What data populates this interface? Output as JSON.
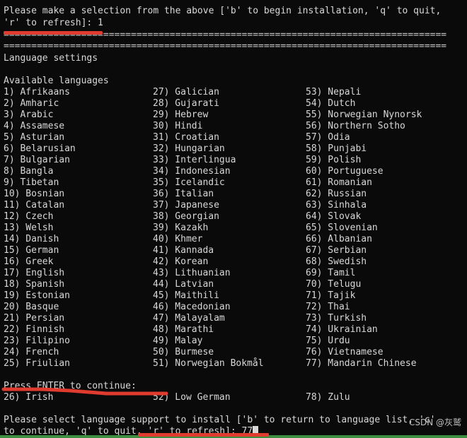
{
  "terminal": {
    "prompt_top_line1": "Please make a selection from the above ['b' to begin installation, 'q' to quit,",
    "prompt_top_line2": "'r' to refresh]: 1",
    "separator1": "================================================================================",
    "separator2": "================================================================================",
    "section_title": "Language settings",
    "list_heading": "Available languages",
    "press_enter": "Press ENTER to continue:",
    "prompt_bottom_line1": "Please select language support to install ['b' to return to language list, 'c'",
    "prompt_bottom_line2": "to continue, 'q' to quit, 'r' to refresh]: 77",
    "watermark": "CSDN @灰鹫"
  },
  "columns": {
    "col1": [
      "1) Afrikaans",
      "2) Amharic",
      "3) Arabic",
      "4) Assamese",
      "5) Asturian",
      "6) Belarusian",
      "7) Bulgarian",
      "8) Bangla",
      "9) Tibetan",
      "10) Bosnian",
      "11) Catalan",
      "12) Czech",
      "13) Welsh",
      "14) Danish",
      "15) German",
      "16) Greek",
      "17) English",
      "18) Spanish",
      "19) Estonian",
      "20) Basque",
      "21) Persian",
      "22) Finnish",
      "23) Filipino",
      "24) French",
      "25) Friulian"
    ],
    "col1_last": "26) Irish",
    "col2": [
      "27) Galician",
      "28) Gujarati",
      "29) Hebrew",
      "30) Hindi",
      "31) Croatian",
      "32) Hungarian",
      "33) Interlingua",
      "34) Indonesian",
      "35) Icelandic",
      "36) Italian",
      "37) Japanese",
      "38) Georgian",
      "39) Kazakh",
      "40) Khmer",
      "41) Kannada",
      "42) Korean",
      "43) Lithuanian",
      "44) Latvian",
      "45) Maithili",
      "46) Macedonian",
      "47) Malayalam",
      "48) Marathi",
      "49) Malay",
      "50) Burmese",
      "51) Norwegian Bokmål"
    ],
    "col2_last": "52) Low German",
    "col3": [
      "53) Nepali",
      "54) Dutch",
      "55) Norwegian Nynorsk",
      "56) Northern Sotho",
      "57) Odia",
      "58) Punjabi",
      "59) Polish",
      "60) Portuguese",
      "61) Romanian",
      "62) Russian",
      "63) Sinhala",
      "64) Slovak",
      "65) Slovenian",
      "66) Albanian",
      "67) Serbian",
      "68) Swedish",
      "69) Tamil",
      "70) Telugu",
      "71) Tajik",
      "72) Thai",
      "73) Turkish",
      "74) Ukrainian",
      "75) Urdu",
      "76) Vietnamese",
      "77) Mandarin Chinese"
    ],
    "col3_last": "78) Zulu"
  },
  "colors": {
    "background": "#0a0a0a",
    "foreground": "#d8d8d8",
    "annotation_red": "#e03b2f",
    "accent_green": "#3e8e41"
  }
}
